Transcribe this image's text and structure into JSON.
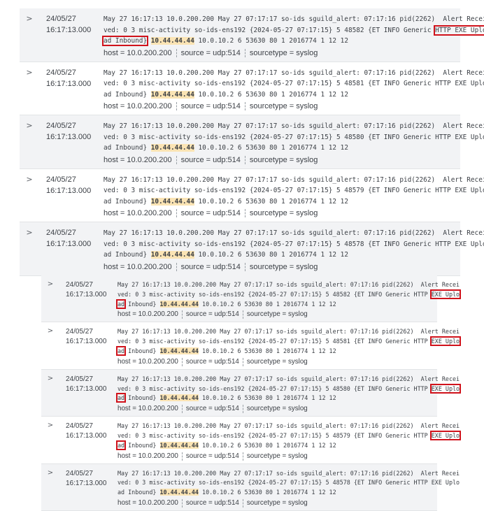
{
  "top_panel": {
    "rows": [
      {
        "expand_icon": "chevron-right-icon",
        "expand_glyph": ">",
        "date": "24/05/27",
        "time": "16:17:13.000",
        "line1": "May 27 16:17:13 10.0.200.200 May 27 07:17:17 so-ids sguild_alert: 07:17:16 pid(2262)  Alert Recei",
        "line2_prefix": "ved: 0 3 misc-activity so-ids-ens192 {2024-05-27 07:17:15} 5 48582 {ET INFO Generic ",
        "line2_highlight": "HTTP EXE Uplo",
        "line3_highlight": "ad Inbound}",
        "ip": "10.44.44.44",
        "line3_rest": " 10.0.10.2 6 53630 80 1 2016774 1 12 12",
        "boxed": true,
        "host": "host = 10.0.200.200",
        "source": "source = udp:514",
        "sourcetype": "sourcetype = syslog"
      },
      {
        "expand_icon": "chevron-right-icon",
        "expand_glyph": ">",
        "date": "24/05/27",
        "time": "16:17:13.000",
        "line1": "May 27 16:17:13 10.0.200.200 May 27 07:17:17 so-ids sguild_alert: 07:17:16 pid(2262)  Alert Recei",
        "line2_prefix": "ved: 0 3 misc-activity so-ids-ens192 {2024-05-27 07:17:15} 5 48581 {ET INFO Generic ",
        "line2_highlight": "HTTP EXE Uplo",
        "line3_highlight": "ad Inbound}",
        "ip": "10.44.44.44",
        "line3_rest": " 10.0.10.2 6 53630 80 1 2016774 1 12 12",
        "boxed": false,
        "host": "host = 10.0.200.200",
        "source": "source = udp:514",
        "sourcetype": "sourcetype = syslog"
      },
      {
        "expand_icon": "chevron-right-icon",
        "expand_glyph": ">",
        "date": "24/05/27",
        "time": "16:17:13.000",
        "line1": "May 27 16:17:13 10.0.200.200 May 27 07:17:17 so-ids sguild_alert: 07:17:16 pid(2262)  Alert Recei",
        "line2_prefix": "ved: 0 3 misc-activity so-ids-ens192 {2024-05-27 07:17:15} 5 48580 {ET INFO Generic ",
        "line2_highlight": "HTTP EXE Uplo",
        "line3_highlight": "ad Inbound}",
        "ip": "10.44.44.44",
        "line3_rest": " 10.0.10.2 6 53630 80 1 2016774 1 12 12",
        "boxed": false,
        "host": "host = 10.0.200.200",
        "source": "source = udp:514",
        "sourcetype": "sourcetype = syslog"
      },
      {
        "expand_icon": "chevron-right-icon",
        "expand_glyph": ">",
        "date": "24/05/27",
        "time": "16:17:13.000",
        "line1": "May 27 16:17:13 10.0.200.200 May 27 07:17:17 so-ids sguild_alert: 07:17:16 pid(2262)  Alert Recei",
        "line2_prefix": "ved: 0 3 misc-activity so-ids-ens192 {2024-05-27 07:17:15} 5 48579 {ET INFO Generic ",
        "line2_highlight": "HTTP EXE Uplo",
        "line3_highlight": "ad Inbound}",
        "ip": "10.44.44.44",
        "line3_rest": " 10.0.10.2 6 53630 80 1 2016774 1 12 12",
        "boxed": false,
        "host": "host = 10.0.200.200",
        "source": "source = udp:514",
        "sourcetype": "sourcetype = syslog"
      },
      {
        "expand_icon": "chevron-right-icon",
        "expand_glyph": ">",
        "date": "24/05/27",
        "time": "16:17:13.000",
        "line1": "May 27 16:17:13 10.0.200.200 May 27 07:17:17 so-ids sguild_alert: 07:17:16 pid(2262)  Alert Recei",
        "line2_prefix": "ved: 0 3 misc-activity so-ids-ens192 {2024-05-27 07:17:15} 5 48578 {ET INFO Generic ",
        "line2_highlight": "HTTP EXE Uplo",
        "line3_highlight": "ad Inbound}",
        "ip": "10.44.44.44",
        "line3_rest": " 10.0.10.2 6 53630 80 1 2016774 1 12 12",
        "boxed": false,
        "host": "host = 10.0.200.200",
        "source": "source = udp:514",
        "sourcetype": "sourcetype = syslog"
      }
    ]
  },
  "bottom_panel": {
    "rows": [
      {
        "expand_icon": "chevron-right-icon",
        "expand_glyph": ">",
        "date": "24/05/27",
        "time": "16:17:13.000",
        "line1": "May 27 16:17:13 10.0.200.200 May 27 07:17:17 so-ids sguild_alert: 07:17:16 pid(2262)  Alert Recei",
        "line2_prefix": "ved: 0 3 misc-activity so-ids-ens192 {2024-05-27 07:17:15} 5 48582 {ET INFO Generic HTTP ",
        "line2_highlight": "EXE Uplo",
        "line3_highlight": "ad",
        "line3_mid": " Inbound} ",
        "ip": "10.44.44.44",
        "line3_rest": " 10.0.10.2 6 53630 80 1 2016774 1 12 12",
        "boxed": true,
        "host": "host = 10.0.200.200",
        "source": "source = udp:514",
        "sourcetype": "sourcetype = syslog"
      },
      {
        "expand_icon": "chevron-right-icon",
        "expand_glyph": ">",
        "date": "24/05/27",
        "time": "16:17:13.000",
        "line1": "May 27 16:17:13 10.0.200.200 May 27 07:17:17 so-ids sguild_alert: 07:17:16 pid(2262)  Alert Recei",
        "line2_prefix": "ved: 0 3 misc-activity so-ids-ens192 {2024-05-27 07:17:15} 5 48581 {ET INFO Generic HTTP ",
        "line2_highlight": "EXE Uplo",
        "line3_highlight": "ad",
        "line3_mid": " Inbound} ",
        "ip": "10.44.44.44",
        "line3_rest": " 10.0.10.2 6 53630 80 1 2016774 1 12 12",
        "boxed": true,
        "host": "host = 10.0.200.200",
        "source": "source = udp:514",
        "sourcetype": "sourcetype = syslog"
      },
      {
        "expand_icon": "chevron-right-icon",
        "expand_glyph": ">",
        "date": "24/05/27",
        "time": "16:17:13.000",
        "line1": "May 27 16:17:13 10.0.200.200 May 27 07:17:17 so-ids sguild_alert: 07:17:16 pid(2262)  Alert Recei",
        "line2_prefix": "ved: 0 3 misc-activity so-ids-ens192 {2024-05-27 07:17:15} 5 48580 {ET INFO Generic HTTP ",
        "line2_highlight": "EXE Uplo",
        "line3_highlight": "ad",
        "line3_mid": " Inbound} ",
        "ip": "10.44.44.44",
        "line3_rest": " 10.0.10.2 6 53630 80 1 2016774 1 12 12",
        "boxed": true,
        "host": "host = 10.0.200.200",
        "source": "source = udp:514",
        "sourcetype": "sourcetype = syslog"
      },
      {
        "expand_icon": "chevron-right-icon",
        "expand_glyph": ">",
        "date": "24/05/27",
        "time": "16:17:13.000",
        "line1": "May 27 16:17:13 10.0.200.200 May 27 07:17:17 so-ids sguild_alert: 07:17:16 pid(2262)  Alert Recei",
        "line2_prefix": "ved: 0 3 misc-activity so-ids-ens192 {2024-05-27 07:17:15} 5 48579 {ET INFO Generic HTTP ",
        "line2_highlight": "EXE Uplo",
        "line3_highlight": "ad",
        "line3_mid": " Inbound} ",
        "ip": "10.44.44.44",
        "line3_rest": " 10.0.10.2 6 53630 80 1 2016774 1 12 12",
        "boxed": true,
        "host": "host = 10.0.200.200",
        "source": "source = udp:514",
        "sourcetype": "sourcetype = syslog"
      },
      {
        "expand_icon": "chevron-right-icon",
        "expand_glyph": ">",
        "date": "24/05/27",
        "time": "16:17:13.000",
        "line1": "May 27 16:17:13 10.0.200.200 May 27 07:17:17 so-ids sguild_alert: 07:17:16 pid(2262)  Alert Recei",
        "line2_prefix": "ved: 0 3 misc-activity so-ids-ens192 {2024-05-27 07:17:15} 5 48578 {ET INFO Generic HTTP ",
        "line2_highlight": "EXE Uplo",
        "line3_highlight": "ad",
        "line3_mid": " Inbound} ",
        "ip": "10.44.44.44",
        "line3_rest": " 10.0.10.2 6 53630 80 1 2016774 1 12 12",
        "boxed": false,
        "host": "host = 10.0.200.200",
        "source": "source = udp:514",
        "sourcetype": "sourcetype = syslog"
      }
    ]
  },
  "colors": {
    "ip_highlight": "#fbe4b4",
    "box_outline": "#d0121b",
    "alt_row": "#f2f3f5"
  }
}
